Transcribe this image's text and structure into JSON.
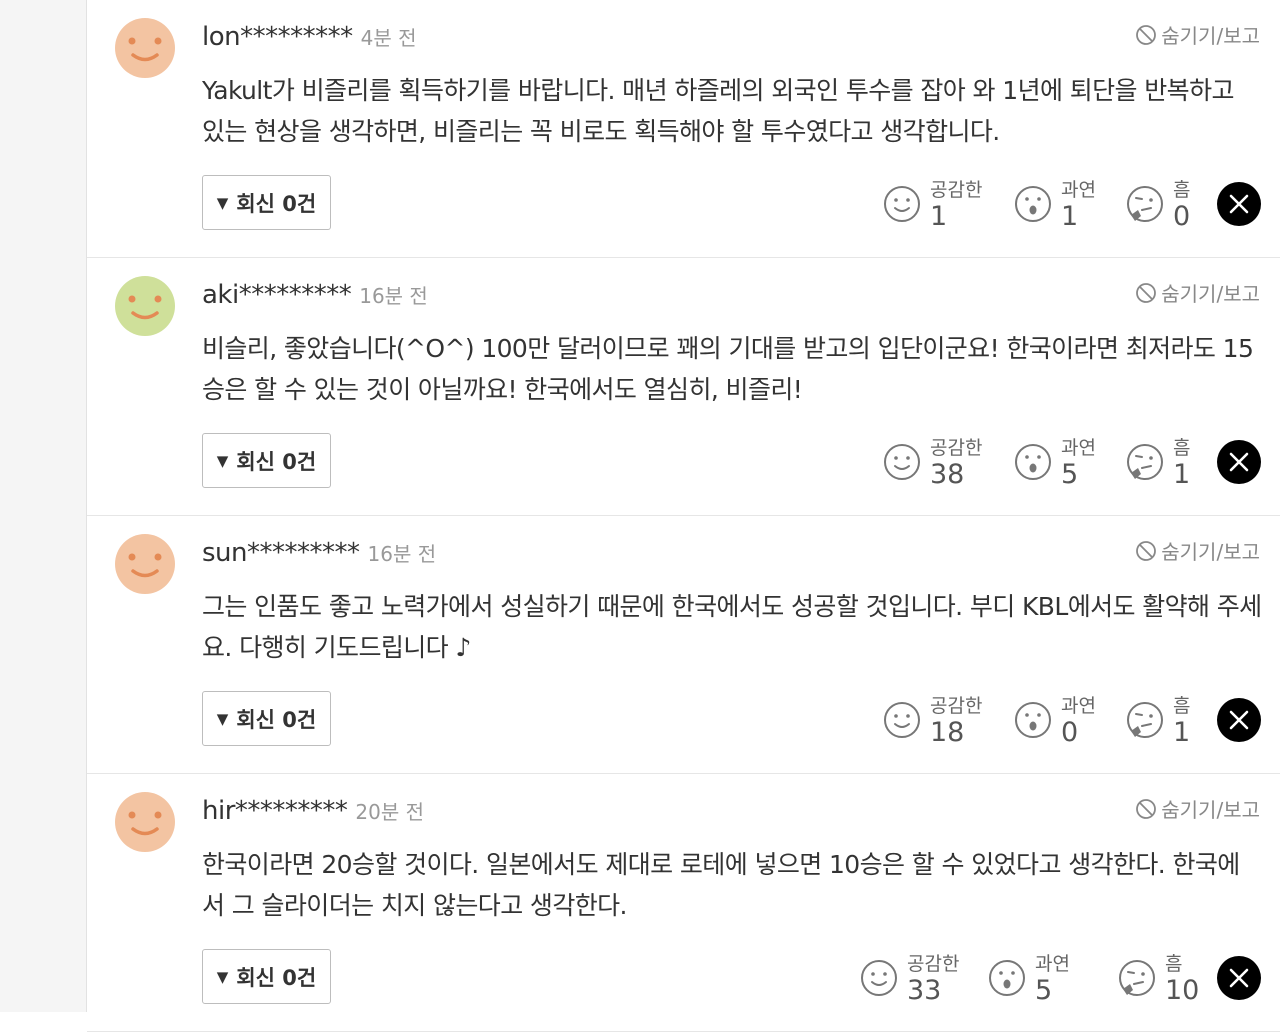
{
  "hide_label": "숨기기/보고",
  "comments": [
    {
      "username": "lon*********",
      "time": "4분 전",
      "avatar_color": "#f3c4a2",
      "text": "Yakult가 비즐리를 획득하기를 바랍니다. 매년 하즐레의 외국인 투수를 잡아 와 1년에 퇴단을 반복하고 있는 현상을 생각하면, 비즐리는 꼭 비로도 획득해야 할 투수였다고 생각합니다.",
      "reply_label": "회신 0건",
      "reactions": [
        {
          "label": "공감한",
          "count": "1",
          "icon": "smile-icon"
        },
        {
          "label": "과연",
          "count": "1",
          "icon": "surprised-icon"
        },
        {
          "label": "흠",
          "count": "0",
          "icon": "thinking-icon"
        }
      ]
    },
    {
      "username": "aki*********",
      "time": "16분 전",
      "avatar_color": "#cfe09a",
      "text": "비슬리, 좋았습니다(^O^) 100만 달러이므로 꽤의 기대를 받고의 입단이군요! 한국이라면 최저라도 15승은 할 수 있는 것이 아닐까요! 한국에서도 열심히, 비즐리!",
      "reply_label": "회신 0건",
      "reactions": [
        {
          "label": "공감한",
          "count": "38",
          "icon": "smile-icon"
        },
        {
          "label": "과연",
          "count": "5",
          "icon": "surprised-icon"
        },
        {
          "label": "흠",
          "count": "1",
          "icon": "thinking-icon"
        }
      ]
    },
    {
      "username": "sun*********",
      "time": "16분 전",
      "avatar_color": "#f3c4a2",
      "text": "그는 인품도 좋고 노력가에서 성실하기 때문에 한국에서도 성공할 것입니다. 부디 KBL에서도 활약해 주세요. 다행히 기도드립니다 ♪",
      "reply_label": "회신 0건",
      "reactions": [
        {
          "label": "공감한",
          "count": "18",
          "icon": "smile-icon"
        },
        {
          "label": "과연",
          "count": "0",
          "icon": "surprised-icon"
        },
        {
          "label": "흠",
          "count": "1",
          "icon": "thinking-icon"
        }
      ]
    },
    {
      "username": "hir*********",
      "time": "20분 전",
      "avatar_color": "#f3c4a2",
      "text": "한국이라면 20승할 것이다. 일본에서도 제대로 로테에 넣으면 10승은 할 수 있었다고 생각한다. 한국에서 그 슬라이더는 치지 않는다고 생각한다.",
      "reply_label": "회신 0건",
      "reactions": [
        {
          "label": "공감한",
          "count": "33",
          "icon": "smile-icon"
        },
        {
          "label": "과연",
          "count": "5",
          "icon": "surprised-icon"
        },
        {
          "label": "흠",
          "count": "10",
          "icon": "thinking-icon"
        }
      ]
    }
  ]
}
